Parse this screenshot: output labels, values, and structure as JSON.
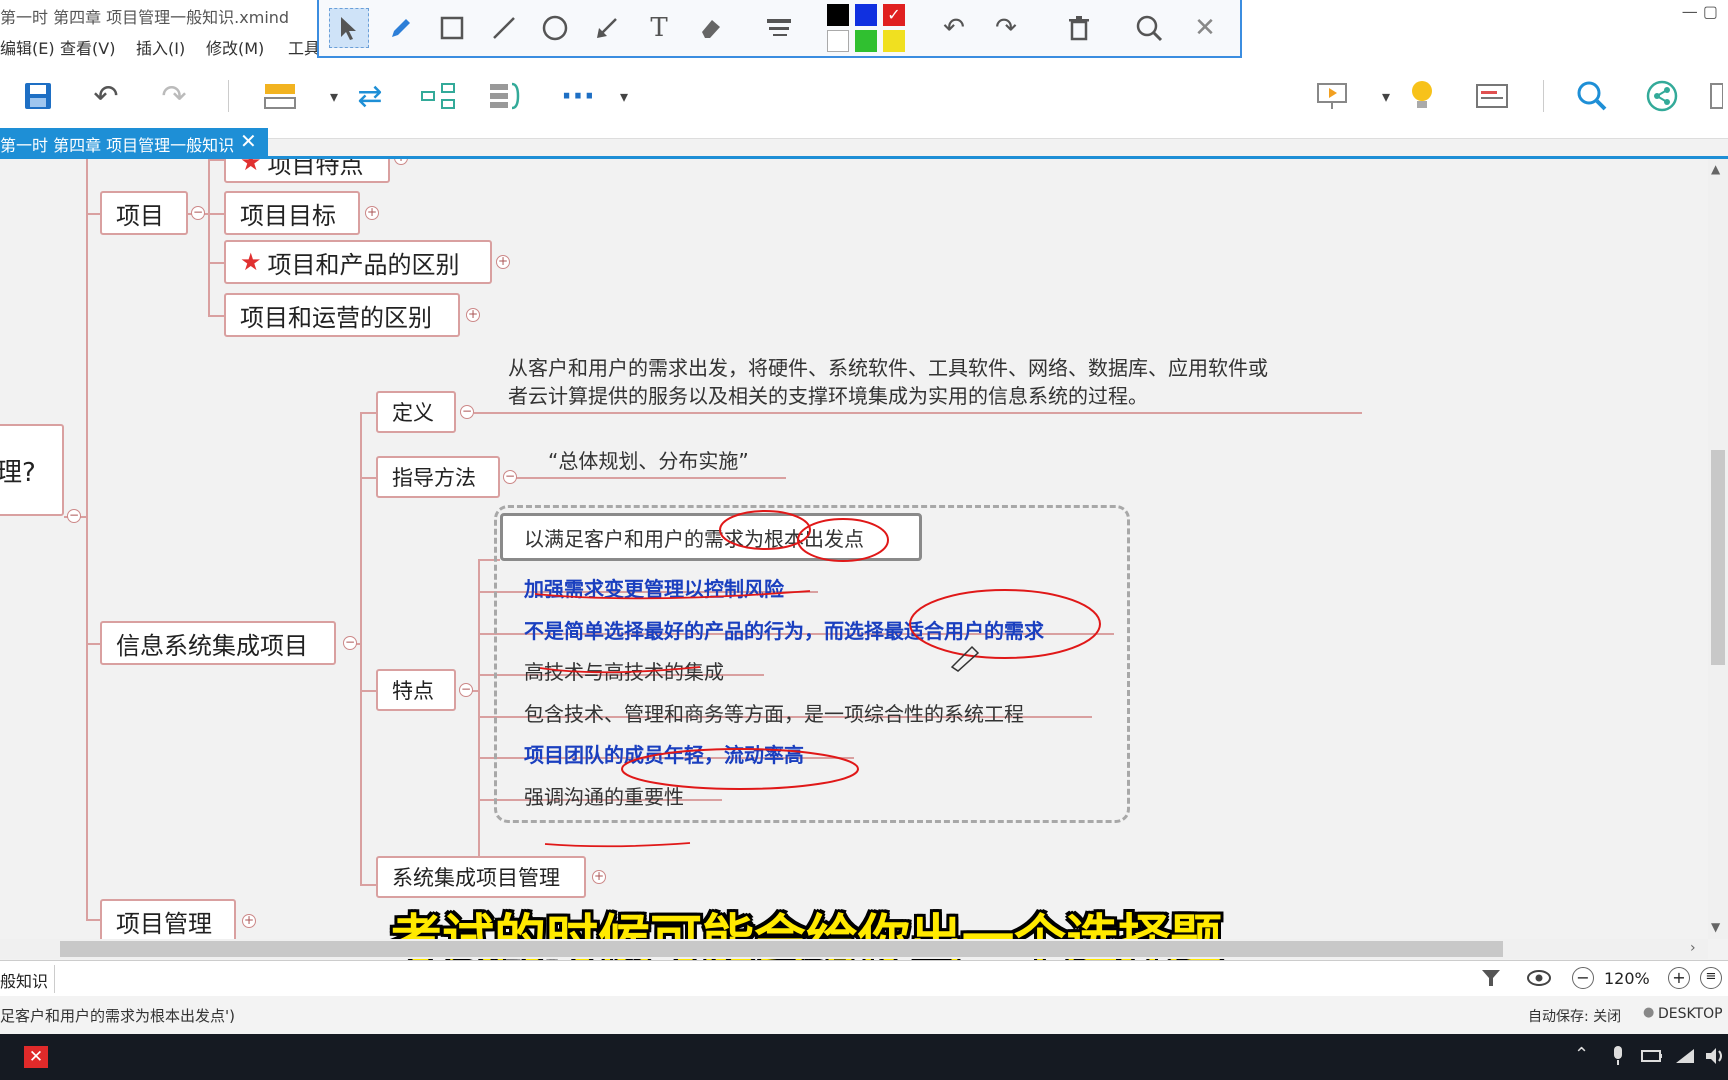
{
  "window": {
    "title": "第一时 第四章 项目管理一般知识.xmind",
    "controls": "—  ▢"
  },
  "menu": [
    "编辑(E)",
    "查看(V)",
    "插入(I)",
    "修改(M)",
    "工具"
  ],
  "annotation_toolbar": {
    "tools": [
      "select-arrow-icon",
      "pen-icon",
      "rectangle-icon",
      "line-icon",
      "circle-icon",
      "arrow-icon",
      "text-icon",
      "eraser-icon",
      "line-style-icon"
    ],
    "colors": [
      "#000000",
      "#1030e0",
      "#e02020",
      "#ffffff",
      "#30c030",
      "#f0e020"
    ],
    "selected_color": "#e02020"
  },
  "tab": {
    "label": "第一时 第四章 项目管理一般知识",
    "close": "✕"
  },
  "map": {
    "root_partial": "理?",
    "project": {
      "label": "项目",
      "children": [
        "项目特点",
        "项目目标",
        "项目和产品的区别",
        "项目和运营的区别"
      ]
    },
    "isi": {
      "label": "信息系统集成项目",
      "definition": {
        "label": "定义",
        "text_line1": "从客户和用户的需求出发，将硬件、系统软件、工具软件、网络、数据库、应用软件或",
        "text_line2": "者云计算提供的服务以及相关的支撑环境集成为实用的信息系统的过程。"
      },
      "method": {
        "label": "指导方法",
        "text": "“总体规划、分布实施”"
      },
      "features": {
        "label": "特点",
        "items": [
          "以满足客户和用户的需求为根本出发点",
          "加强需求变更管理以控制风险",
          "不是简单选择最好的产品的行为，而选择最适合用户的需求",
          "高技术与高技术的集成",
          "包含技术、管理和商务等方面，是一项综合性的系统工程",
          "项目团队的成员年轻，流动率高",
          "强调沟通的重要性"
        ]
      },
      "sys_mgmt": {
        "label": "系统集成项目管理"
      }
    },
    "project_mgmt": {
      "label": "项目管理"
    }
  },
  "subtitle": "考试的时候可能会给你出一个选择题",
  "filterbar": {
    "left_label": "般知识",
    "zoom": "120%"
  },
  "statusbar": {
    "left": "足客户和用户的需求为根本出发点')",
    "autosave": "自动保存: 关闭",
    "host": "DESKTOP"
  }
}
